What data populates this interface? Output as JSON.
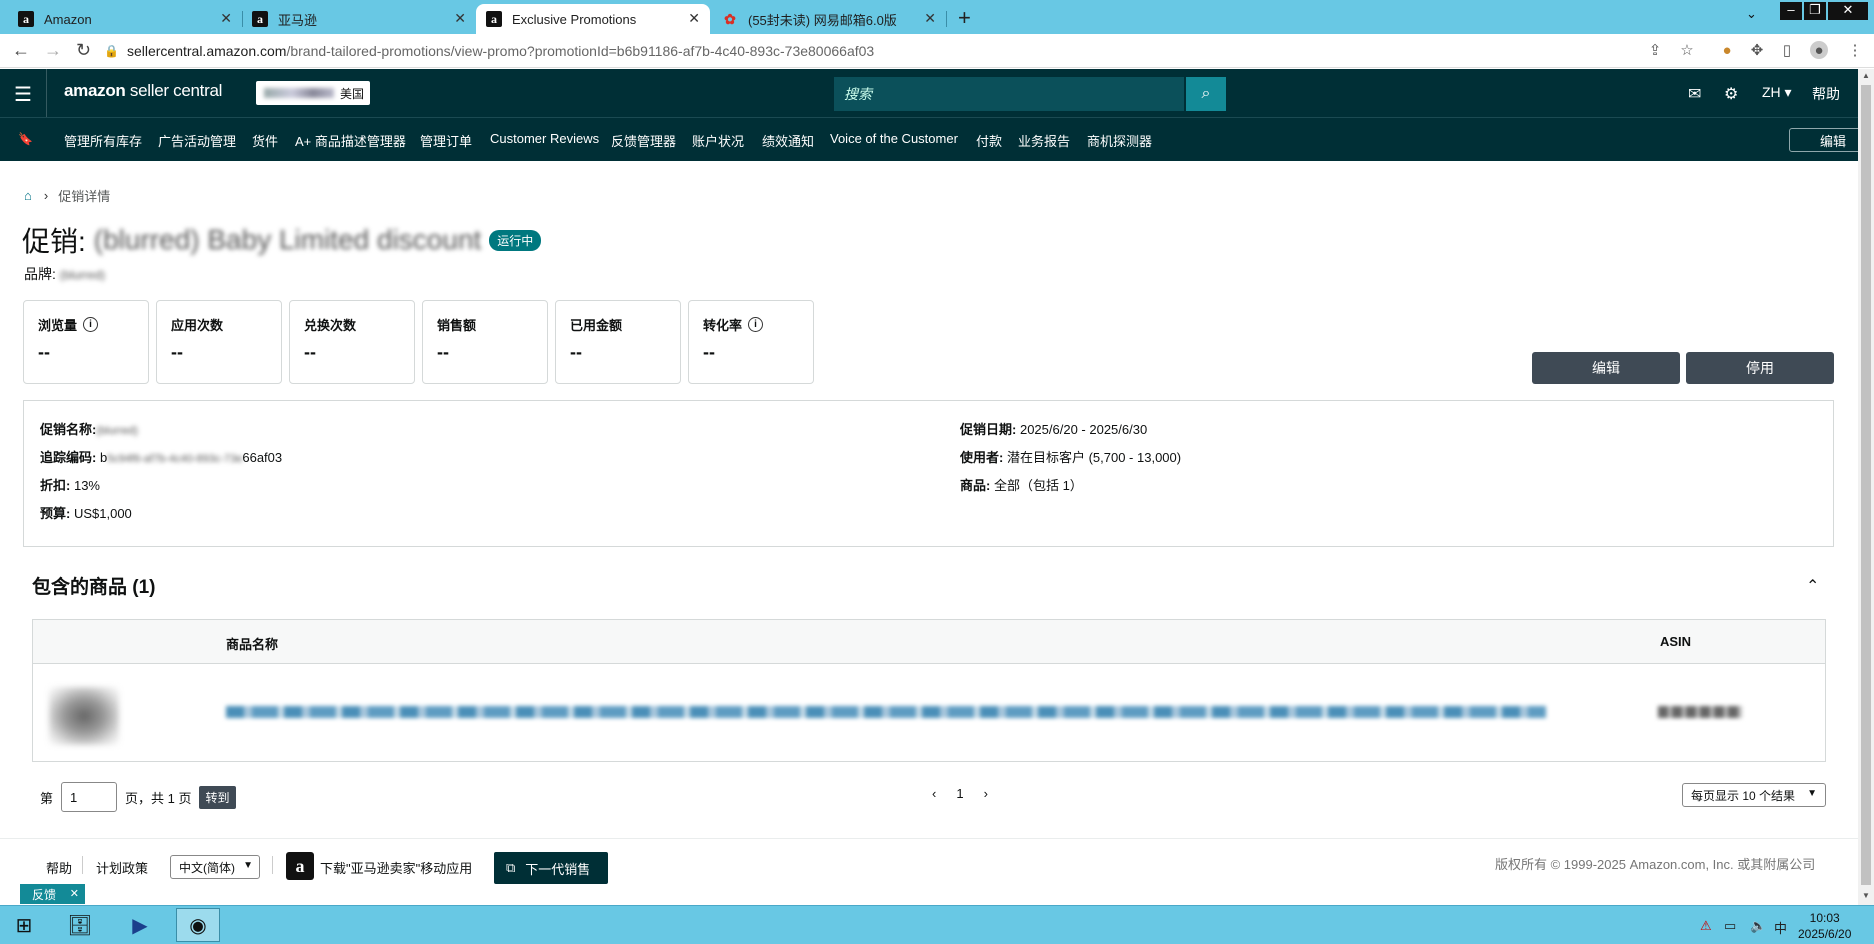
{
  "browser": {
    "tabs": [
      {
        "title": "Amazon",
        "icon": "amazon-favicon"
      },
      {
        "title": "亚马逊",
        "icon": "amazon-favicon"
      },
      {
        "title": "Exclusive Promotions",
        "icon": "amazon-favicon"
      },
      {
        "title": "(55封未读) 网易邮箱6.0版",
        "icon": "netease-mail-favicon"
      }
    ],
    "url_host": "sellercentral.amazon.com",
    "url_path": "/brand-tailored-promotions/view-promo?promotionId=b6b91186-af7b-4c40-893c-73e80066af03"
  },
  "header": {
    "logo_bold": "amazon",
    "logo_rest": " seller central",
    "marketplace": "美国",
    "search_placeholder": "搜索",
    "lang": "ZH",
    "help": "帮助"
  },
  "nav": {
    "items": [
      "管理所有库存",
      "广告活动管理",
      "货件",
      "A+ 商品描述管理器",
      "管理订单",
      "Customer Reviews",
      "反馈管理器",
      "账户状况",
      "绩效通知",
      "Voice of the Customer",
      "付款",
      "业务报告",
      "商机探测器"
    ],
    "edit": "编辑"
  },
  "breadcrumb": {
    "current": "促销详情"
  },
  "promo": {
    "title_prefix": "促销:",
    "title_name": "(blurred) Baby Limited discount",
    "status": "运行中",
    "brand_label": "品牌:",
    "brand_value": "(blurred)"
  },
  "metrics": [
    {
      "label": "浏览量",
      "value": "--",
      "info": true
    },
    {
      "label": "应用次数",
      "value": "--",
      "info": false
    },
    {
      "label": "兑换次数",
      "value": "--",
      "info": false
    },
    {
      "label": "销售额",
      "value": "--",
      "info": false
    },
    {
      "label": "已用金额",
      "value": "--",
      "info": false
    },
    {
      "label": "转化率",
      "value": "--",
      "info": true
    }
  ],
  "actions": {
    "edit": "编辑",
    "deactivate": "停用"
  },
  "details": {
    "name_label": "促销名称:",
    "name_value": "(blurred)",
    "tracking_label": "追踪编码:",
    "tracking_prefix": "b",
    "tracking_suffix": "66af03",
    "discount_label": "折扣:",
    "discount_value": "13%",
    "budget_label": "预算:",
    "budget_value": "US$1,000",
    "dates_label": "促销日期:",
    "dates_value": "2025/6/20 - 2025/6/30",
    "audience_label": "使用者:",
    "audience_value": "潜在目标客户 (5,700 - 13,000)",
    "products_label": "商品:",
    "products_value": "全部（包括 1）"
  },
  "products": {
    "section_title": "包含的商品 (1)",
    "col_name": "商品名称",
    "col_asin": "ASIN"
  },
  "pager": {
    "page_prefix": "第",
    "page_value": "1",
    "page_suffix": "页，共 1 页",
    "goto": "转到",
    "current": "1",
    "per_page": "每页显示 10 个结果"
  },
  "footer": {
    "help": "帮助",
    "policy": "计划政策",
    "language": "中文(简体)",
    "app_text": "下载\"亚马逊卖家\"移动应用",
    "next_gen": "下一代销售",
    "copyright": "版权所有 © 1999-2025 Amazon.com, Inc. 或其附属公司",
    "feedback": "反馈"
  },
  "taskbar": {
    "time": "10:03",
    "date": "2025/6/20",
    "ime": "中"
  },
  "colors": {
    "header_bg": "#002f36",
    "accent_teal": "#138a97",
    "status_badge": "#00787f",
    "browser_chrome": "#68c8e4"
  }
}
